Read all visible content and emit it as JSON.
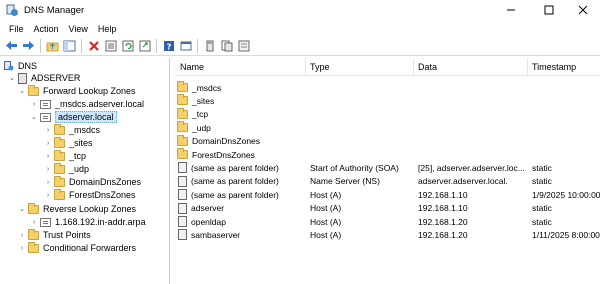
{
  "window": {
    "title": "DNS Manager"
  },
  "menu": [
    "File",
    "Action",
    "View",
    "Help"
  ],
  "toolbar": {
    "buttons": [
      "back-arrow-icon",
      "forward-arrow-icon",
      "up-folder-icon",
      "show-tree-icon",
      "delete-icon",
      "properties-icon",
      "refresh-icon",
      "export-icon",
      "help-icon",
      "console-icon",
      "server-icon",
      "zone-icon"
    ]
  },
  "tree": {
    "root": "DNS",
    "server": "ADSERVER",
    "forward": "Forward Lookup Zones",
    "msdcs_zone": "_msdcs.adserver.local",
    "adserver_zone": "adserver.local",
    "sub": [
      "_msdcs",
      "_sites",
      "_tcp",
      "_udp",
      "DomainDnsZones",
      "ForestDnsZones"
    ],
    "reverse": "Reverse Lookup Zones",
    "reverse_zone": "1.168.192.in-addr.arpa",
    "trust": "Trust Points",
    "cond": "Conditional Forwarders"
  },
  "list": {
    "columns": [
      "Name",
      "Type",
      "Data",
      "Timestamp"
    ],
    "rows": [
      {
        "kind": "folder",
        "name": "_msdcs",
        "type": "",
        "data": "",
        "timestamp": ""
      },
      {
        "kind": "folder",
        "name": "_sites",
        "type": "",
        "data": "",
        "timestamp": ""
      },
      {
        "kind": "folder",
        "name": "_tcp",
        "type": "",
        "data": "",
        "timestamp": ""
      },
      {
        "kind": "folder",
        "name": "_udp",
        "type": "",
        "data": "",
        "timestamp": ""
      },
      {
        "kind": "folder",
        "name": "DomainDnsZones",
        "type": "",
        "data": "",
        "timestamp": ""
      },
      {
        "kind": "folder",
        "name": "ForestDnsZones",
        "type": "",
        "data": "",
        "timestamp": ""
      },
      {
        "kind": "record",
        "name": "(same as parent folder)",
        "type": "Start of Authority (SOA)",
        "data": "[25], adserver.adserver.loc...",
        "timestamp": "static"
      },
      {
        "kind": "record",
        "name": "(same as parent folder)",
        "type": "Name Server (NS)",
        "data": "adserver.adserver.local.",
        "timestamp": "static"
      },
      {
        "kind": "record",
        "name": "(same as parent folder)",
        "type": "Host (A)",
        "data": "192.168.1.10",
        "timestamp": "1/9/2025 10:00:00"
      },
      {
        "kind": "record",
        "name": "adserver",
        "type": "Host (A)",
        "data": "192.168.1.10",
        "timestamp": "static"
      },
      {
        "kind": "record",
        "name": "openldap",
        "type": "Host (A)",
        "data": "192.168.1.20",
        "timestamp": "static"
      },
      {
        "kind": "record",
        "name": "sambaserver",
        "type": "Host (A)",
        "data": "192.168.1.20",
        "timestamp": "1/11/2025 8:00:00"
      }
    ]
  },
  "colors": {
    "folder": "#f5d06a",
    "selection": "#cce8ff",
    "accent": "#1e6fd0"
  }
}
